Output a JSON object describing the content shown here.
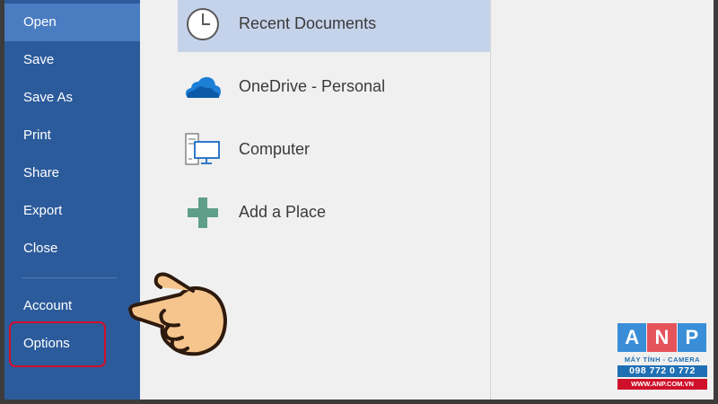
{
  "sidebar": {
    "items": [
      {
        "label": "Open",
        "active": true
      },
      {
        "label": "Save"
      },
      {
        "label": "Save As"
      },
      {
        "label": "Print"
      },
      {
        "label": "Share"
      },
      {
        "label": "Export"
      },
      {
        "label": "Close"
      },
      {
        "label": "Account"
      },
      {
        "label": "Options",
        "highlighted": true
      }
    ]
  },
  "places": [
    {
      "label": "Recent Documents",
      "icon": "clock-icon",
      "selected": true
    },
    {
      "label": "OneDrive - Personal",
      "icon": "onedrive-cloud-icon"
    },
    {
      "label": "Computer",
      "icon": "computer-icon"
    },
    {
      "label": "Add a Place",
      "icon": "plus-icon"
    }
  ],
  "colors": {
    "sidebar": "#2c5b9b",
    "sidebar_active": "#4a7cc2",
    "selected_place": "#c5d3ea",
    "highlight_border": "#d0102a"
  },
  "logo": {
    "letters": [
      "A",
      "N",
      "P"
    ],
    "subtitle": "MÁY TÍNH - CAMERA",
    "phone": "098 772 0 772",
    "website": "WWW.ANP.COM.VN"
  }
}
